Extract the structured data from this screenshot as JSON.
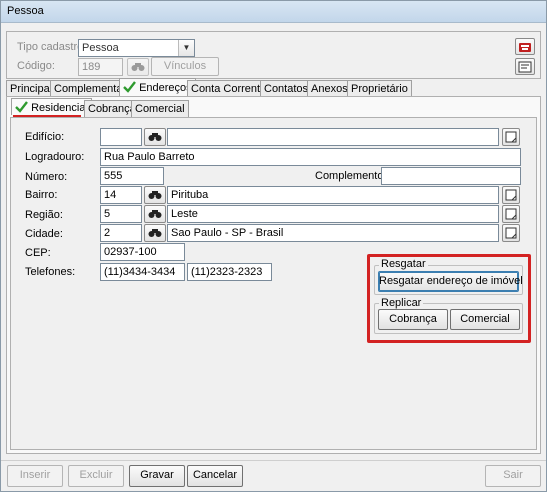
{
  "window": {
    "title": "Pessoa"
  },
  "header": {
    "tipo_cadastro_label": "Tipo cadastro",
    "tipo_cadastro_value": "Pessoa",
    "codigo_label": "Código:",
    "codigo_value": "189",
    "vinculos_label": "Vínculos"
  },
  "tabs": [
    {
      "label": "Principal"
    },
    {
      "label": "Complementar"
    },
    {
      "label": "Endereços"
    },
    {
      "label": "Conta Corrente"
    },
    {
      "label": "Contatos"
    },
    {
      "label": "Anexos"
    },
    {
      "label": "Proprietário"
    }
  ],
  "subtabs": [
    {
      "label": "Residencial"
    },
    {
      "label": "Cobrança"
    },
    {
      "label": "Comercial"
    }
  ],
  "form": {
    "edificio_label": "Edifício:",
    "edificio_code": "",
    "edificio_name": "",
    "logradouro_label": "Logradouro:",
    "logradouro_value": "Rua Paulo Barreto",
    "numero_label": "Número:",
    "numero_value": "555",
    "complemento_label": "Complemento:",
    "complemento_value": "",
    "bairro_label": "Bairro:",
    "bairro_code": "14",
    "bairro_name": "Pirituba",
    "regiao_label": "Região:",
    "regiao_code": "5",
    "regiao_name": "Leste",
    "cidade_label": "Cidade:",
    "cidade_code": "2",
    "cidade_name": "Sao Paulo - SP - Brasil",
    "cep_label": "CEP:",
    "cep_value": "02937-100",
    "telefones_label": "Telefones:",
    "telefone1": "(11)3434-3434",
    "telefone2": "(11)2323-2323"
  },
  "resgatar": {
    "group_label": "Resgatar",
    "button_label": "Resgatar endereço de imóvel"
  },
  "replicar": {
    "group_label": "Replicar",
    "cobranca_label": "Cobrança",
    "comercial_label": "Comercial"
  },
  "footer": {
    "inserir": "Inserir",
    "excluir": "Excluir",
    "gravar": "Gravar",
    "cancelar": "Cancelar",
    "sair": "Sair"
  },
  "colors": {
    "highlight_red": "#d32222",
    "check_green": "#2e9a2e"
  }
}
